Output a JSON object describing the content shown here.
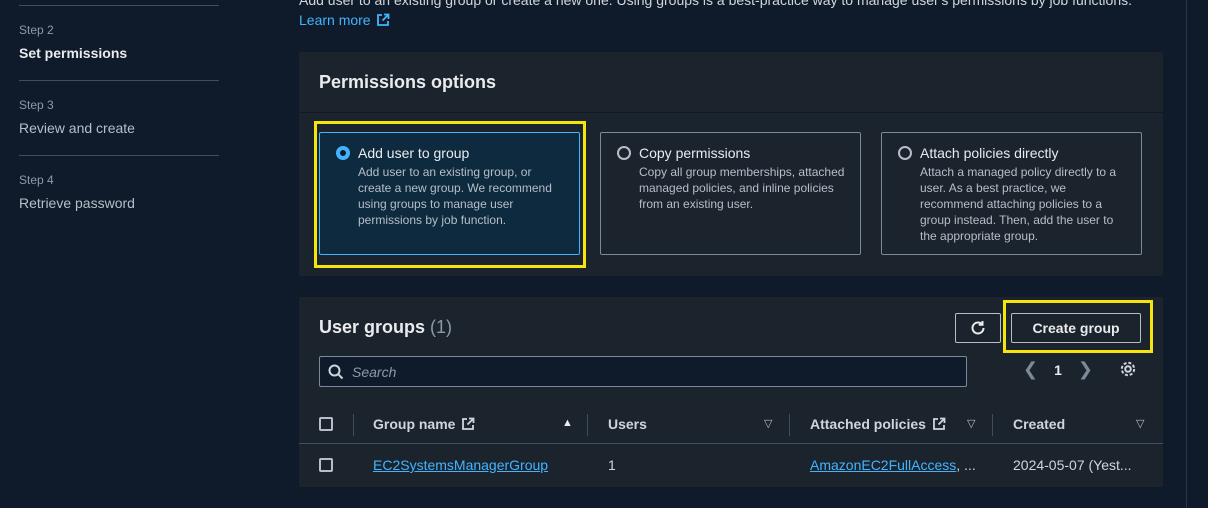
{
  "sidebar": {
    "steps": [
      {
        "number": "Step 2",
        "title": "Set permissions",
        "active": true
      },
      {
        "number": "Step 3",
        "title": "Review and create",
        "active": false
      },
      {
        "number": "Step 4",
        "title": "Retrieve password",
        "active": false
      }
    ]
  },
  "intro": {
    "text": "Add user to an existing group or create a new one. Using groups is a best-practice way to manage user's permissions by job functions.",
    "learn_more": "Learn more"
  },
  "permissions": {
    "title": "Permissions options",
    "options": [
      {
        "label": "Add user to group",
        "description": "Add user to an existing group, or create a new group. We recommend using groups to manage user permissions by job function.",
        "selected": true
      },
      {
        "label": "Copy permissions",
        "description": "Copy all group memberships, attached managed policies, and inline policies from an existing user.",
        "selected": false
      },
      {
        "label": "Attach policies directly",
        "description": "Attach a managed policy directly to a user. As a best practice, we recommend attaching policies to a group instead. Then, add the user to the appropriate group.",
        "selected": false
      }
    ]
  },
  "user_groups": {
    "title": "User groups",
    "count": "(1)",
    "refresh_icon": "refresh-icon",
    "create_label": "Create group",
    "search_placeholder": "Search",
    "page": "1",
    "columns": {
      "group_name": "Group name",
      "users": "Users",
      "attached_policies": "Attached policies",
      "created": "Created"
    },
    "rows": [
      {
        "group_name": "EC2SystemsManagerGroup",
        "users": "1",
        "policy": "AmazonEC2FullAccess",
        "policy_more": ", ...",
        "created": "2024-05-07 (Yest..."
      }
    ]
  },
  "colors": {
    "accent": "#42b4ff",
    "highlight": "#f5e50a",
    "background": "#0f1b2a",
    "panel": "#1b232d"
  }
}
